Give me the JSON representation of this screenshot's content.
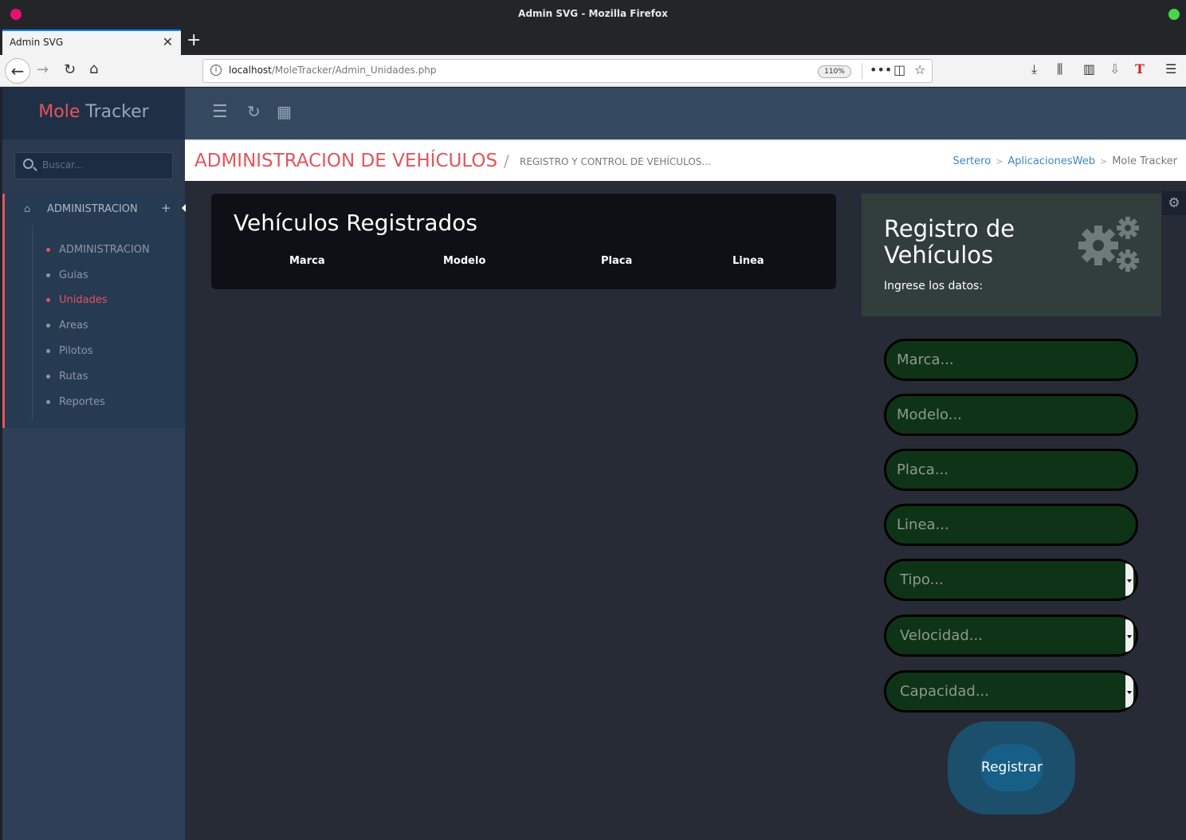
{
  "window": {
    "title": "Admin SVG - Mozilla Firefox"
  },
  "tab": {
    "title": "Admin SVG",
    "close": "✕"
  },
  "browser": {
    "url_host": "localhost",
    "url_path": "/MoleTracker/Admin_Unidades.php",
    "zoom": "110%"
  },
  "brand": {
    "part1": "Mole",
    "part2": "Tracker"
  },
  "sidebar": {
    "search_placeholder": "Buscar...",
    "section": "ADMINISTRACION",
    "items": [
      {
        "label": "ADMINISTRACION",
        "active": false,
        "red": true
      },
      {
        "label": "Guias",
        "active": false,
        "red": false
      },
      {
        "label": "Unidades",
        "active": true,
        "red": true
      },
      {
        "label": "Areas",
        "active": false,
        "red": false
      },
      {
        "label": "Pilotos",
        "active": false,
        "red": false
      },
      {
        "label": "Rutas",
        "active": false,
        "red": false
      },
      {
        "label": "Reportes",
        "active": false,
        "red": false
      }
    ]
  },
  "header": {
    "title": "ADMINISTRACION DE VEHÍCULOS",
    "subtitle": "REGISTRO Y CONTROL DE VEHÍCULOS...",
    "breadcrumbs": [
      "Sertero",
      "AplicacionesWeb",
      "Mole Tracker"
    ]
  },
  "table": {
    "title": "Vehículos Registrados",
    "columns": [
      "Marca",
      "Modelo",
      "Placa",
      "Linea"
    ]
  },
  "form": {
    "title": "Registro de Vehículos",
    "subtitle": "Ingrese los datos:",
    "inputs": [
      {
        "placeholder": "Marca..."
      },
      {
        "placeholder": "Modelo..."
      },
      {
        "placeholder": "Placa..."
      },
      {
        "placeholder": "Linea..."
      }
    ],
    "selects": [
      {
        "value": "Tipo..."
      },
      {
        "value": "Velocidad..."
      },
      {
        "value": "Capacidad..."
      }
    ],
    "submit_label": "Registrar"
  },
  "colors": {
    "accent_red": "#e5545a",
    "field_green": "#0f3317",
    "button_blue": "#175f86"
  }
}
